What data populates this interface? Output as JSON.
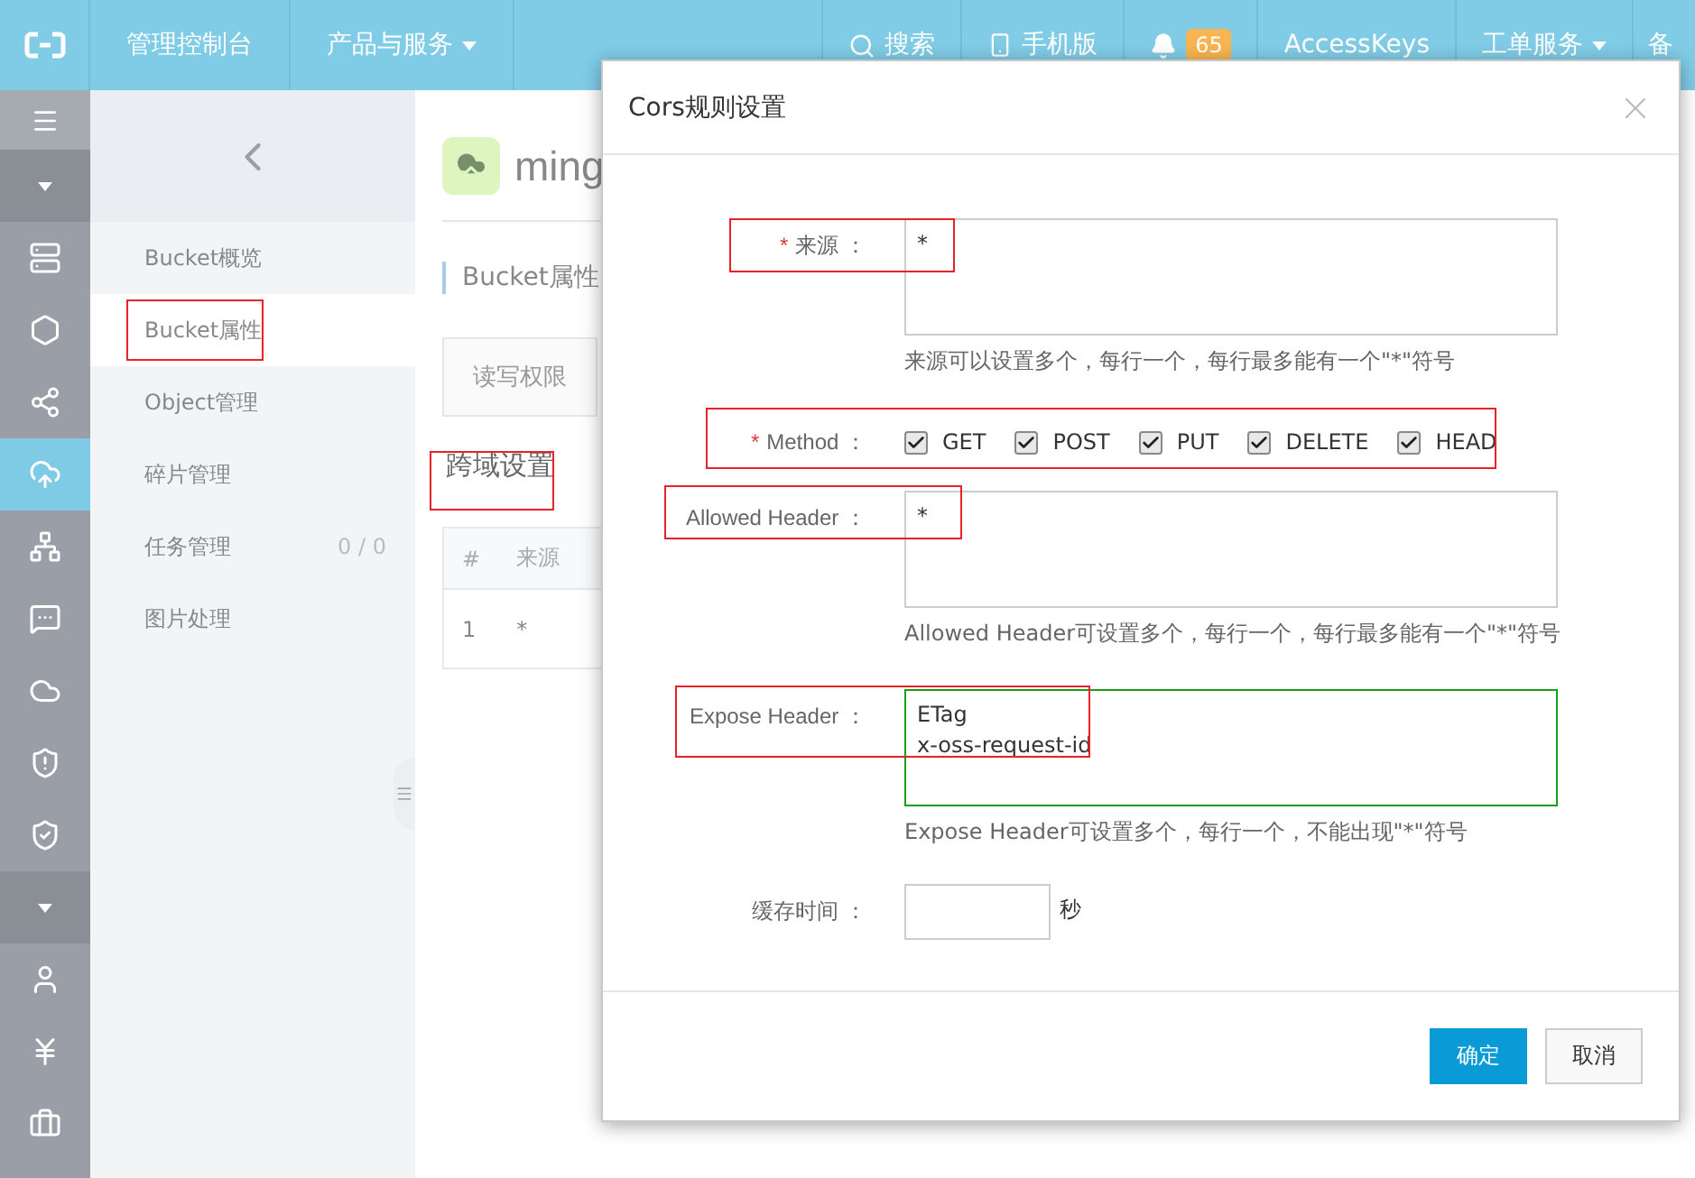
{
  "top_bar": {
    "console": "管理控制台",
    "products": "产品与服务",
    "search": "搜索",
    "mobile": "手机版",
    "notifications": "65",
    "access_keys": "AccessKeys",
    "tickets": "工单服务",
    "filing": "备"
  },
  "icon_rail": [
    {
      "kind": "menu"
    },
    {
      "kind": "toggle"
    },
    {
      "kind": "nav",
      "selected": false
    },
    {
      "kind": "nav",
      "selected": false
    },
    {
      "kind": "nav",
      "selected": false
    },
    {
      "kind": "nav",
      "selected": true
    },
    {
      "kind": "nav",
      "selected": false
    },
    {
      "kind": "nav",
      "selected": false
    },
    {
      "kind": "nav",
      "selected": false
    },
    {
      "kind": "nav",
      "selected": false
    },
    {
      "kind": "nav",
      "selected": false
    },
    {
      "kind": "toggle"
    },
    {
      "kind": "nav",
      "selected": false
    },
    {
      "kind": "nav",
      "selected": false
    },
    {
      "kind": "nav",
      "selected": false
    }
  ],
  "sidebar": {
    "items": [
      {
        "label": "Bucket概览",
        "selected": false
      },
      {
        "label": "Bucket属性",
        "selected": true
      },
      {
        "label": "Object管理",
        "selected": false
      },
      {
        "label": "碎片管理",
        "selected": false
      },
      {
        "label": "任务管理",
        "selected": false,
        "count": "0 / 0"
      },
      {
        "label": "图片处理",
        "selected": false
      }
    ]
  },
  "main": {
    "bucket_name": "ming",
    "section_title": "Bucket属性",
    "tabs": [
      "读写权限"
    ],
    "subsection": "跨域设置",
    "table": {
      "columns": [
        "#",
        "来源"
      ],
      "rows": [
        [
          "1",
          "*"
        ]
      ]
    }
  },
  "dialog": {
    "title": "Cors规则设置",
    "fields": [
      {
        "kind": "textarea",
        "required_mark": "*",
        "label": "来源 ：",
        "value": "*",
        "help": "来源可以设置多个，每行一个，每行最多能有一个\"*\"符号"
      },
      {
        "kind": "checkboxes",
        "required_mark": "*",
        "label": "Method ：",
        "options": [
          {
            "label": "GET",
            "checked": true
          },
          {
            "label": "POST",
            "checked": true
          },
          {
            "label": "PUT",
            "checked": true
          },
          {
            "label": "DELETE",
            "checked": true
          },
          {
            "label": "HEAD",
            "checked": true
          }
        ]
      },
      {
        "kind": "textarea",
        "label": "Allowed Header ：",
        "value": "*",
        "help": "Allowed Header可设置多个，每行一个，每行最多能有一个\"*\"符号"
      },
      {
        "kind": "textarea",
        "label": "Expose Header ：",
        "value": "ETag\nx-oss-request-id",
        "focused": true,
        "help": "Expose Header可设置多个，每行一个，不能出现\"*\"符号"
      },
      {
        "kind": "number",
        "label": "缓存时间 ：",
        "unit": "秒"
      }
    ],
    "buttons": [
      {
        "label": "确定",
        "kind": "primary"
      },
      {
        "label": "取消",
        "kind": "default"
      }
    ]
  }
}
